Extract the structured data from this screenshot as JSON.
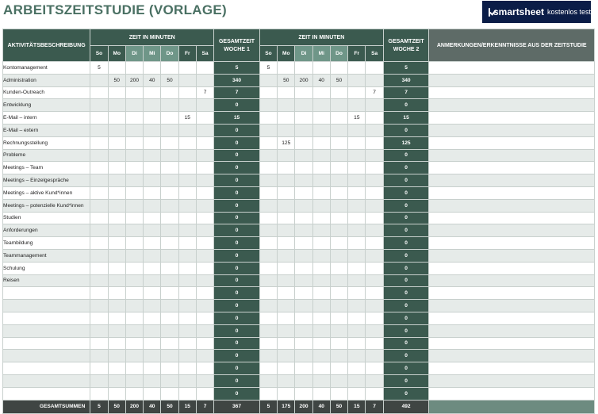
{
  "title": "ARBEITSZEITSTUDIE (VORLAGE)",
  "banner": {
    "brand": "smartsheet",
    "cta": "kostenlos testen"
  },
  "headers": {
    "activity": "AKTIVITÄTSBESCHREIBUNG",
    "time_week1": "ZEIT IN MINUTEN",
    "total_week1_line1": "GESAMTZEIT",
    "total_week1_line2": "WOCHE 1",
    "time_week2": "ZEIT IN MINUTEN",
    "total_week2_line1": "GESAMTZEIT",
    "total_week2_line2": "WOCHE 2",
    "notes": "ANMERKUNGEN/ERKENNTNISSE AUS DER ZEITSTUDIE"
  },
  "days": [
    "So",
    "Mo",
    "Di",
    "Mi",
    "Do",
    "Fr",
    "Sa"
  ],
  "rows": [
    {
      "activity": "Kontomanagement",
      "w1": [
        "5",
        "",
        "",
        "",
        "",
        "",
        ""
      ],
      "t1": "5",
      "w2": [
        "5",
        "",
        "",
        "",
        "",
        "",
        ""
      ],
      "t2": "5"
    },
    {
      "activity": "Administration",
      "w1": [
        "",
        "50",
        "200",
        "40",
        "50",
        "",
        ""
      ],
      "t1": "340",
      "w2": [
        "",
        "50",
        "200",
        "40",
        "50",
        "",
        ""
      ],
      "t2": "340"
    },
    {
      "activity": "Kunden-Outreach",
      "w1": [
        "",
        "",
        "",
        "",
        "",
        "",
        "7"
      ],
      "t1": "7",
      "w2": [
        "",
        "",
        "",
        "",
        "",
        "",
        "7"
      ],
      "t2": "7"
    },
    {
      "activity": "Entwicklung",
      "w1": [
        "",
        "",
        "",
        "",
        "",
        "",
        ""
      ],
      "t1": "0",
      "w2": [
        "",
        "",
        "",
        "",
        "",
        "",
        ""
      ],
      "t2": "0"
    },
    {
      "activity": "E-Mail – intern",
      "w1": [
        "",
        "",
        "",
        "",
        "",
        "15",
        ""
      ],
      "t1": "15",
      "w2": [
        "",
        "",
        "",
        "",
        "",
        "15",
        ""
      ],
      "t2": "15"
    },
    {
      "activity": "E-Mail – extern",
      "w1": [
        "",
        "",
        "",
        "",
        "",
        "",
        ""
      ],
      "t1": "0",
      "w2": [
        "",
        "",
        "",
        "",
        "",
        "",
        ""
      ],
      "t2": "0"
    },
    {
      "activity": "Rechnungsstellung",
      "w1": [
        "",
        "",
        "",
        "",
        "",
        "",
        ""
      ],
      "t1": "0",
      "w2": [
        "",
        "125",
        "",
        "",
        "",
        "",
        ""
      ],
      "t2": "125"
    },
    {
      "activity": "Probleme",
      "w1": [
        "",
        "",
        "",
        "",
        "",
        "",
        ""
      ],
      "t1": "0",
      "w2": [
        "",
        "",
        "",
        "",
        "",
        "",
        ""
      ],
      "t2": "0"
    },
    {
      "activity": "Meetings – Team",
      "w1": [
        "",
        "",
        "",
        "",
        "",
        "",
        ""
      ],
      "t1": "0",
      "w2": [
        "",
        "",
        "",
        "",
        "",
        "",
        ""
      ],
      "t2": "0"
    },
    {
      "activity": "Meetings – Einzelgespräche",
      "w1": [
        "",
        "",
        "",
        "",
        "",
        "",
        ""
      ],
      "t1": "0",
      "w2": [
        "",
        "",
        "",
        "",
        "",
        "",
        ""
      ],
      "t2": "0"
    },
    {
      "activity": "Meetings – aktive Kund*innen",
      "w1": [
        "",
        "",
        "",
        "",
        "",
        "",
        ""
      ],
      "t1": "0",
      "w2": [
        "",
        "",
        "",
        "",
        "",
        "",
        ""
      ],
      "t2": "0"
    },
    {
      "activity": "Meetings – potenzielle Kund*innen",
      "w1": [
        "",
        "",
        "",
        "",
        "",
        "",
        ""
      ],
      "t1": "0",
      "w2": [
        "",
        "",
        "",
        "",
        "",
        "",
        ""
      ],
      "t2": "0"
    },
    {
      "activity": "Studien",
      "w1": [
        "",
        "",
        "",
        "",
        "",
        "",
        ""
      ],
      "t1": "0",
      "w2": [
        "",
        "",
        "",
        "",
        "",
        "",
        ""
      ],
      "t2": "0"
    },
    {
      "activity": "Anforderungen",
      "w1": [
        "",
        "",
        "",
        "",
        "",
        "",
        ""
      ],
      "t1": "0",
      "w2": [
        "",
        "",
        "",
        "",
        "",
        "",
        ""
      ],
      "t2": "0"
    },
    {
      "activity": "Teambildung",
      "w1": [
        "",
        "",
        "",
        "",
        "",
        "",
        ""
      ],
      "t1": "0",
      "w2": [
        "",
        "",
        "",
        "",
        "",
        "",
        ""
      ],
      "t2": "0"
    },
    {
      "activity": "Teammanagement",
      "w1": [
        "",
        "",
        "",
        "",
        "",
        "",
        ""
      ],
      "t1": "0",
      "w2": [
        "",
        "",
        "",
        "",
        "",
        "",
        ""
      ],
      "t2": "0"
    },
    {
      "activity": "Schulung",
      "w1": [
        "",
        "",
        "",
        "",
        "",
        "",
        ""
      ],
      "t1": "0",
      "w2": [
        "",
        "",
        "",
        "",
        "",
        "",
        ""
      ],
      "t2": "0"
    },
    {
      "activity": "Reisen",
      "w1": [
        "",
        "",
        "",
        "",
        "",
        "",
        ""
      ],
      "t1": "0",
      "w2": [
        "",
        "",
        "",
        "",
        "",
        "",
        ""
      ],
      "t2": "0"
    },
    {
      "activity": "",
      "w1": [
        "",
        "",
        "",
        "",
        "",
        "",
        ""
      ],
      "t1": "0",
      "w2": [
        "",
        "",
        "",
        "",
        "",
        "",
        ""
      ],
      "t2": "0"
    },
    {
      "activity": "",
      "w1": [
        "",
        "",
        "",
        "",
        "",
        "",
        ""
      ],
      "t1": "0",
      "w2": [
        "",
        "",
        "",
        "",
        "",
        "",
        ""
      ],
      "t2": "0"
    },
    {
      "activity": "",
      "w1": [
        "",
        "",
        "",
        "",
        "",
        "",
        ""
      ],
      "t1": "0",
      "w2": [
        "",
        "",
        "",
        "",
        "",
        "",
        ""
      ],
      "t2": "0"
    },
    {
      "activity": "",
      "w1": [
        "",
        "",
        "",
        "",
        "",
        "",
        ""
      ],
      "t1": "0",
      "w2": [
        "",
        "",
        "",
        "",
        "",
        "",
        ""
      ],
      "t2": "0"
    },
    {
      "activity": "",
      "w1": [
        "",
        "",
        "",
        "",
        "",
        "",
        ""
      ],
      "t1": "0",
      "w2": [
        "",
        "",
        "",
        "",
        "",
        "",
        ""
      ],
      "t2": "0"
    },
    {
      "activity": "",
      "w1": [
        "",
        "",
        "",
        "",
        "",
        "",
        ""
      ],
      "t1": "0",
      "w2": [
        "",
        "",
        "",
        "",
        "",
        "",
        ""
      ],
      "t2": "0"
    },
    {
      "activity": "",
      "w1": [
        "",
        "",
        "",
        "",
        "",
        "",
        ""
      ],
      "t1": "0",
      "w2": [
        "",
        "",
        "",
        "",
        "",
        "",
        ""
      ],
      "t2": "0"
    },
    {
      "activity": "",
      "w1": [
        "",
        "",
        "",
        "",
        "",
        "",
        ""
      ],
      "t1": "0",
      "w2": [
        "",
        "",
        "",
        "",
        "",
        "",
        ""
      ],
      "t2": "0"
    },
    {
      "activity": "",
      "w1": [
        "",
        "",
        "",
        "",
        "",
        "",
        ""
      ],
      "t1": "0",
      "w2": [
        "",
        "",
        "",
        "",
        "",
        "",
        ""
      ],
      "t2": "0"
    }
  ],
  "footer": {
    "label": "GESAMTSUMMEN",
    "w1": [
      "5",
      "50",
      "200",
      "40",
      "50",
      "15",
      "7"
    ],
    "t1": "367",
    "w2": [
      "5",
      "175",
      "200",
      "40",
      "50",
      "15",
      "7"
    ],
    "t2": "492"
  }
}
